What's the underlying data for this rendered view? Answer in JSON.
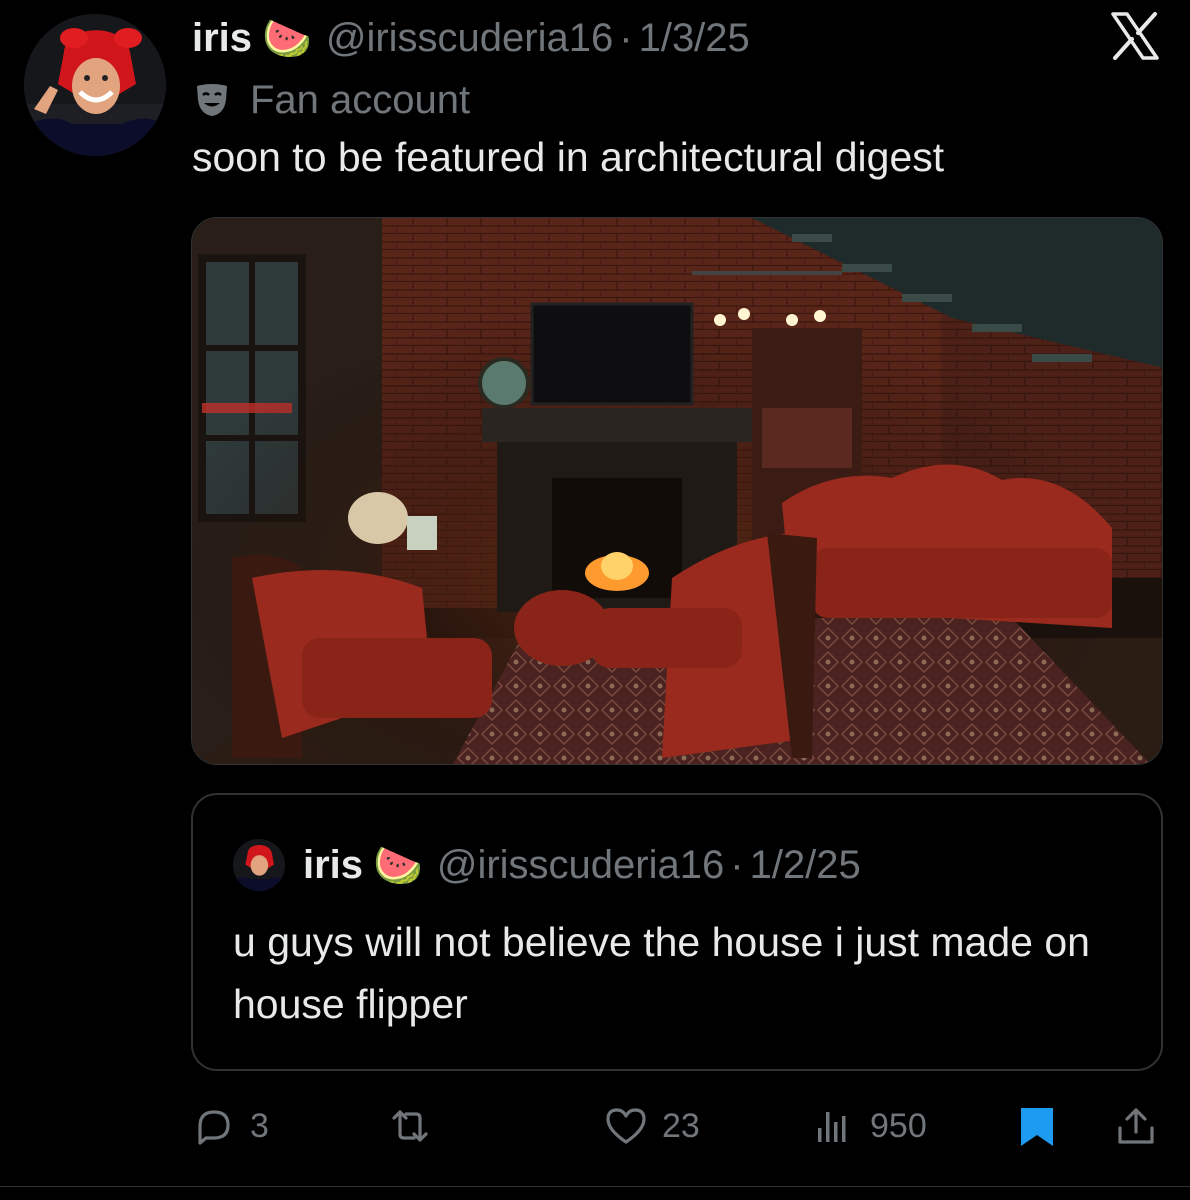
{
  "tweet": {
    "display_name": "iris",
    "name_emoji": "🍉",
    "handle": "@irisscuderia16",
    "separator": "·",
    "date": "1/3/25",
    "account_label": "Fan account",
    "text": "soon to be featured in architectural digest"
  },
  "quoted_tweet": {
    "display_name": "iris",
    "name_emoji": "🍉",
    "handle": "@irisscuderia16",
    "separator": "·",
    "date": "1/2/25",
    "text": "u guys will not believe the house i just made on house flipper"
  },
  "actions": {
    "replies": "3",
    "likes": "23",
    "views": "950"
  },
  "icons": [
    "x-logo-icon",
    "theater-mask-icon",
    "reply-icon",
    "retweet-icon",
    "like-icon",
    "views-icon",
    "bookmark-icon",
    "share-icon"
  ],
  "colors": {
    "background": "#000000",
    "text": "#e7e9ea",
    "muted": "#71767b",
    "border": "#2f3336",
    "bookmark": "#1d9bf0"
  }
}
